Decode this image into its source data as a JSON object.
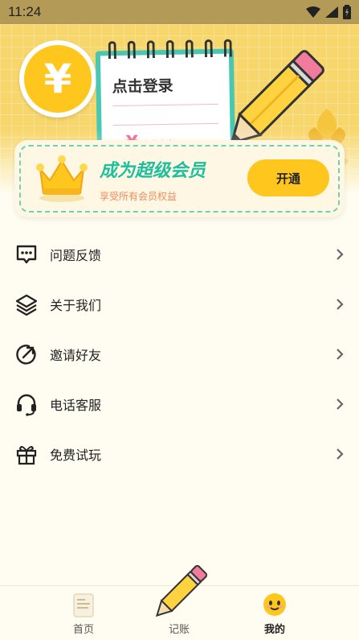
{
  "status_bar": {
    "time": "11:24"
  },
  "header": {
    "currency_symbol": "¥",
    "login_text": "点击登录",
    "balance_symbol": "¥",
    "balance_masked": "****"
  },
  "vip": {
    "title": "成为超级会员",
    "subtitle": "享受所有会员权益",
    "open_button": "开通"
  },
  "menu": [
    {
      "icon": "feedback-icon",
      "label": "问题反馈"
    },
    {
      "icon": "layers-icon",
      "label": "关于我们"
    },
    {
      "icon": "share-icon",
      "label": "邀请好友"
    },
    {
      "icon": "headset-icon",
      "label": "电话客服"
    },
    {
      "icon": "gift-icon",
      "label": "免费试玩"
    }
  ],
  "tabbar": [
    {
      "icon": "document-icon",
      "label": "首页",
      "active": false
    },
    {
      "icon": "pencil-icon",
      "label": "记账",
      "active": false
    },
    {
      "icon": "smiley-icon",
      "label": "我的",
      "active": true
    }
  ],
  "colors": {
    "accent": "#ffc61e",
    "teal": "#1fbf9c",
    "pink": "#ee5f92",
    "background": "#fffcf1"
  }
}
